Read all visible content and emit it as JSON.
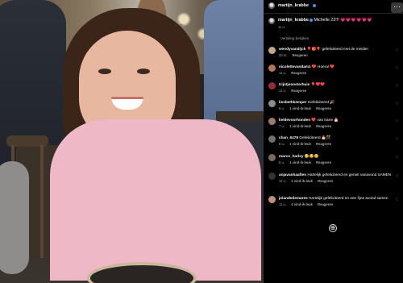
{
  "post": {
    "author": "martijn_krabbe",
    "caption_author": "martijn_krabbe",
    "caption_text": "Michelle 22!!!",
    "caption_emojis": "💗💗💗💗💗💗",
    "caption_time": "11 u.",
    "translate_label": "Vertaling bekijken"
  },
  "actions": {
    "more_label": "···",
    "add_icon": "⊕"
  },
  "comments": [
    {
      "user": "wendyvandijck",
      "text": "🎈🎁🎈 gefeliciteerd met de meidie!",
      "time": "20 m.",
      "likes": "",
      "reply": "Reageren",
      "avatar_color": "#c9a58a"
    },
    {
      "user": "nicolettevandam1",
      "text": "❤️ Hoera! ❤️",
      "time": "11 u.",
      "likes": "",
      "reply": "Reageren",
      "avatar_color": "#b9735b"
    },
    {
      "user": "trijntjeoosterhuis",
      "text": "🎈❤️❤️",
      "time": "11 u.",
      "likes": "",
      "reply": "Reageren",
      "avatar_color": "#9a2b34"
    },
    {
      "user": "liesbethkemper",
      "text": "Gefeliciteerd 🎉",
      "time": "8 u.",
      "likes": "1 vind-ik-leuk",
      "reply": "Reageren",
      "avatar_color": "#8d8d8d"
    },
    {
      "user": "lieldevoorhonden",
      "text": "❤️ van harte 🎂",
      "time": "7 u.",
      "likes": "1 vind-ik-leuk",
      "reply": "Reageren",
      "avatar_color": "#a07a6a"
    },
    {
      "user": "chan_6478",
      "text": "Gefeliciteerd 🎂🎊",
      "time": "8 u.",
      "likes": "1 vind-ik-leuk",
      "reply": "Reageren",
      "avatar_color": "#6f6f6f"
    },
    {
      "user": "marco_harley",
      "text": "😊😊😊",
      "time": "8 u.",
      "likes": "1 vind-ik-leuk",
      "reply": "Reageren",
      "avatar_color": "#7a6b5c"
    },
    {
      "user": "anjavanhaaften",
      "text": "Hartelijk gefeliciteerd en geniet vanavond SAMEN",
      "time": "11 u.",
      "likes": "1 vind-ik-leuk",
      "reply": "Reageren",
      "avatar_color": "#333333"
    },
    {
      "user": "jolandedemaree",
      "text": "Hartelijk gefeliciteerd en een fijne avond samen",
      "time": "11 u.",
      "likes": "4 vind-ik-leuk",
      "reply": "Reageren",
      "avatar_color": "#c0907a"
    }
  ],
  "icons": {
    "heart": "heart-outline-icon",
    "verified": "verified-badge-icon",
    "more": "more-options-icon",
    "add": "add-circle-icon"
  },
  "colors": {
    "background": "#000000",
    "text": "#fafafa",
    "meta": "#a8a8a8",
    "verified": "#3897f0"
  }
}
